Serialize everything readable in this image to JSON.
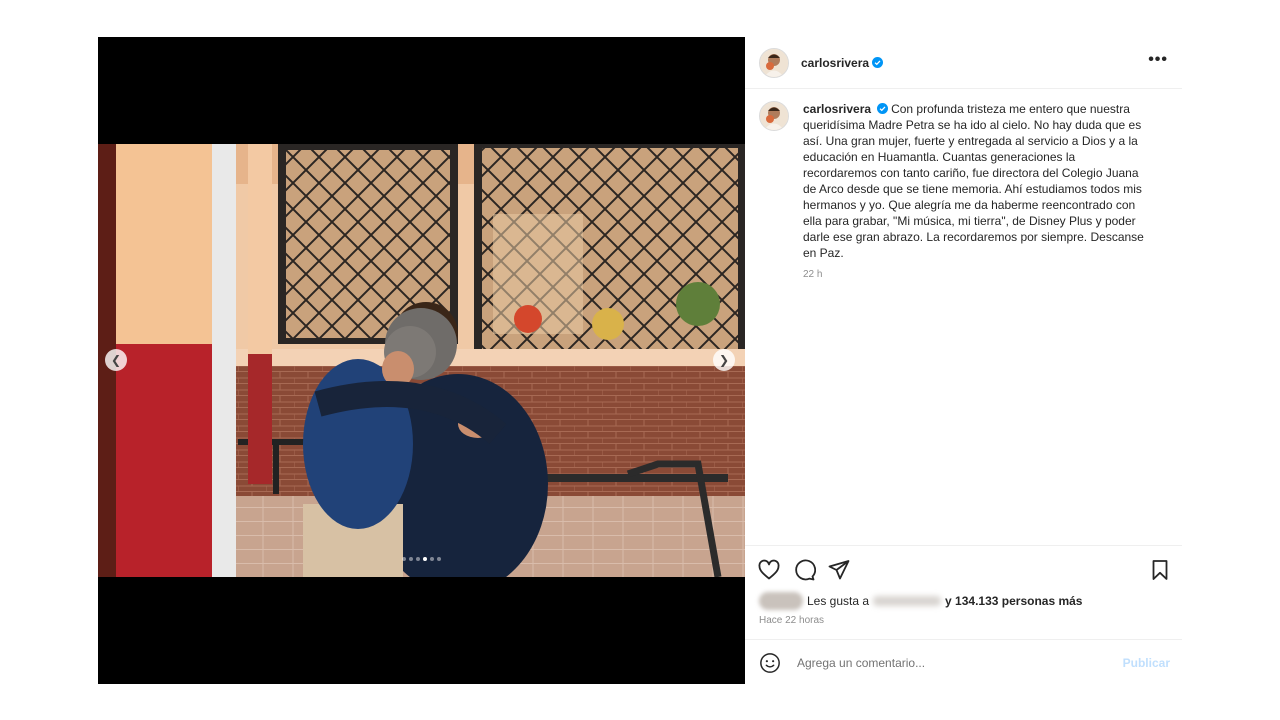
{
  "author": {
    "username": "carlosrivera",
    "verified": true
  },
  "caption": {
    "text": "Con profunda tristeza me entero que nuestra queridísima Madre Petra se ha ido al cielo. No hay duda que es así. Una gran mujer, fuerte y entregada al servicio a Dios y a la educación en Huamantla. Cuantas generaciones la recordaremos con tanto cariño, fue directora del Colegio Juana de Arco desde que se tiene memoria. Ahí estudiamos todos mis hermanos y yo. Que alegría me da haberme reencontrado con ella para grabar, \"Mi música, mi tierra\", de Disney Plus y poder darle ese gran abrazo. La recordaremos por siempre. Descanse en Paz.",
    "time": "22 h"
  },
  "carousel": {
    "total_slides": 6,
    "active_index": 3
  },
  "likes": {
    "prefix": "Les gusta a",
    "suffix": "y 134.133 personas más"
  },
  "posted_ago": "Hace 22 horas",
  "comment": {
    "placeholder": "Agrega un comentario...",
    "publish_label": "Publicar"
  },
  "icons": {
    "more": "more-options-icon",
    "like": "heart-icon",
    "comment": "comment-icon",
    "share": "send-icon",
    "save": "bookmark-icon",
    "emoji": "emoji-icon",
    "prev": "chevron-left-icon",
    "next": "chevron-right-icon"
  },
  "colors": {
    "verified": "#0095f6",
    "publish": "#c0dffd",
    "muted": "#8e8e8e"
  }
}
